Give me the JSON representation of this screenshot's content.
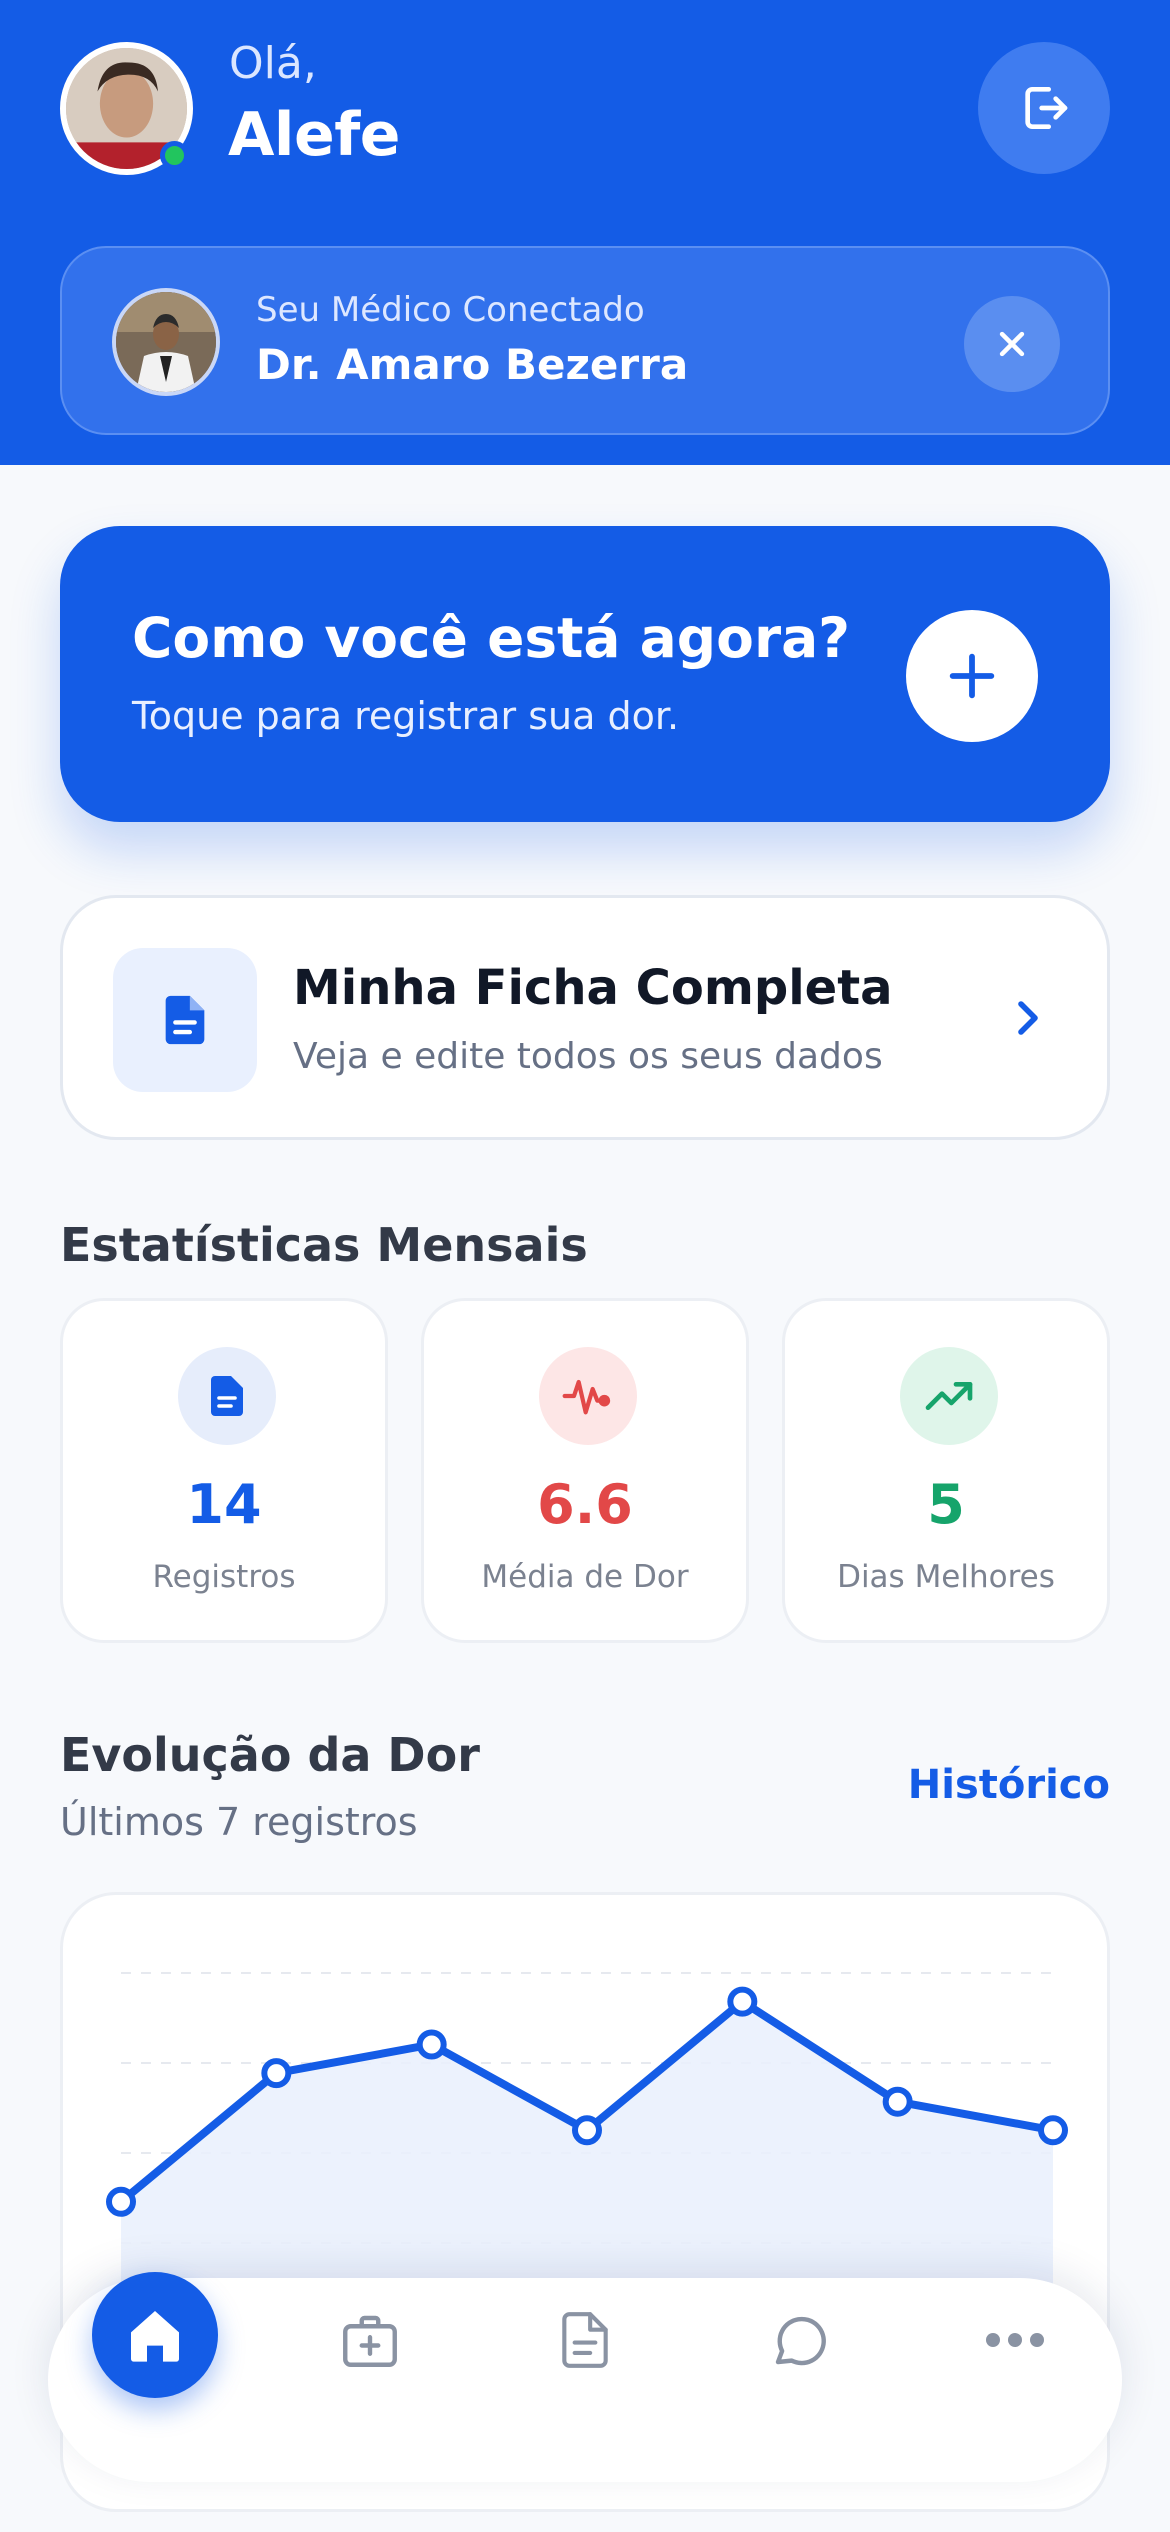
{
  "header": {
    "greeting": "Olá,",
    "user_name": "Alefe",
    "doctor_label": "Seu Médico Conectado",
    "doctor_name": "Dr. Amaro Bezerra"
  },
  "cta": {
    "title": "Como você está agora?",
    "subtitle": "Toque para registrar sua dor."
  },
  "ficha": {
    "title": "Minha Ficha Completa",
    "subtitle": "Veja e edite todos os seus dados"
  },
  "stats": {
    "title": "Estatísticas Mensais",
    "items": [
      {
        "value": "14",
        "label": "Registros",
        "color": "#145ce6",
        "icon": "document-icon"
      },
      {
        "value": "6.6",
        "label": "Média de Dor",
        "color": "#e24848",
        "icon": "pulse-icon"
      },
      {
        "value": "5",
        "label": "Dias Melhores",
        "color": "#16a46b",
        "icon": "trending-up-icon"
      }
    ]
  },
  "evolution": {
    "title": "Evolução da Dor",
    "subtitle": "Últimos 7 registros",
    "history_link": "Histórico"
  },
  "chart_data": {
    "type": "area",
    "title": "",
    "xlabel": "",
    "ylabel": "",
    "grid": true,
    "color": "#145ce6",
    "values": [
      2,
      6.5,
      7.5,
      4.5,
      9,
      5.5,
      4.5
    ],
    "ylim": [
      0,
      10
    ]
  },
  "nav": {
    "items": [
      {
        "icon": "home-icon",
        "active": true
      },
      {
        "icon": "medical-kit-icon",
        "active": false
      },
      {
        "icon": "document-icon",
        "active": false
      },
      {
        "icon": "chat-icon",
        "active": false
      },
      {
        "icon": "more-icon",
        "active": false
      }
    ]
  },
  "colors": {
    "primary": "#145ce6",
    "danger": "#e24848",
    "success": "#16a46b"
  }
}
